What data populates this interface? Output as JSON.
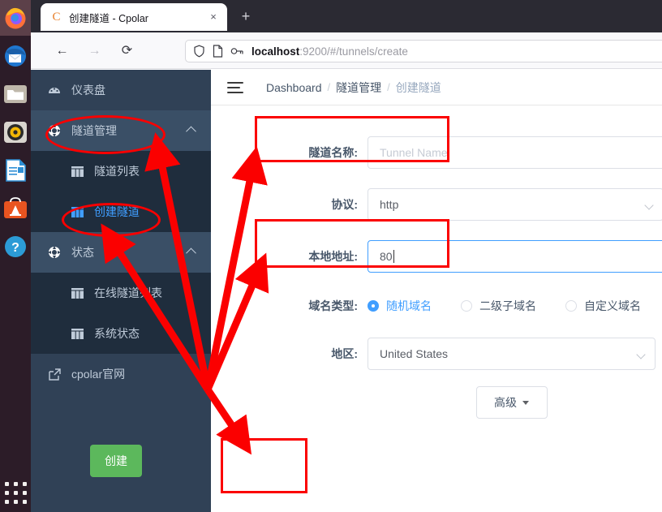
{
  "browser": {
    "tab": {
      "favicon_letter": "C",
      "title": "创建隧道 - Cpolar",
      "close": "×"
    },
    "new_tab_label": "+",
    "nav": {
      "back": "←",
      "forward": "→",
      "reload": "⟳"
    },
    "url": {
      "host": "localhost",
      "rest": ":9200/#/tunnels/create"
    }
  },
  "sidebar": {
    "items": [
      {
        "label": "仪表盘",
        "icon": "dashboard-icon"
      },
      {
        "label": "隧道管理",
        "icon": "node-icon",
        "caret": true
      },
      {
        "label": "隧道列表",
        "icon": "grid-icon"
      },
      {
        "label": "创建隧道",
        "icon": "grid-icon"
      },
      {
        "label": "状态",
        "icon": "node-icon",
        "caret": true
      },
      {
        "label": "在线隧道列表",
        "icon": "grid-icon"
      },
      {
        "label": "系统状态",
        "icon": "grid-icon"
      },
      {
        "label": "cpolar官网",
        "icon": "external-link-icon"
      }
    ]
  },
  "breadcrumb": {
    "root": "Dashboard",
    "sep": "/",
    "middle": "隧道管理",
    "current": "创建隧道"
  },
  "form": {
    "tunnel_name": {
      "label": "隧道名称:",
      "value": "",
      "placeholder": "Tunnel Name"
    },
    "protocol": {
      "label": "协议:",
      "value": "http"
    },
    "local_addr": {
      "label": "本地地址:",
      "value": "80"
    },
    "domain_type": {
      "label": "域名类型:",
      "options": [
        "随机域名",
        "二级子域名",
        "自定义域名"
      ],
      "selected": "随机域名"
    },
    "region": {
      "label": "地区:",
      "value": "United States"
    },
    "advanced_button": "高级",
    "create_button": "创建"
  },
  "colors": {
    "sidebar_bg": "#304156",
    "sidebar_sub_bg": "#1f2d3d",
    "accent_blue": "#409eff",
    "create_green": "#5cb85c",
    "annotation_red": "#fb0000"
  },
  "annotations": {
    "boxes": [
      "tunnel-name-field",
      "local-address-field",
      "create-button"
    ],
    "ellipses": [
      "sidebar-tunnel-management",
      "sidebar-create-tunnel"
    ],
    "arrow_count": 4
  }
}
